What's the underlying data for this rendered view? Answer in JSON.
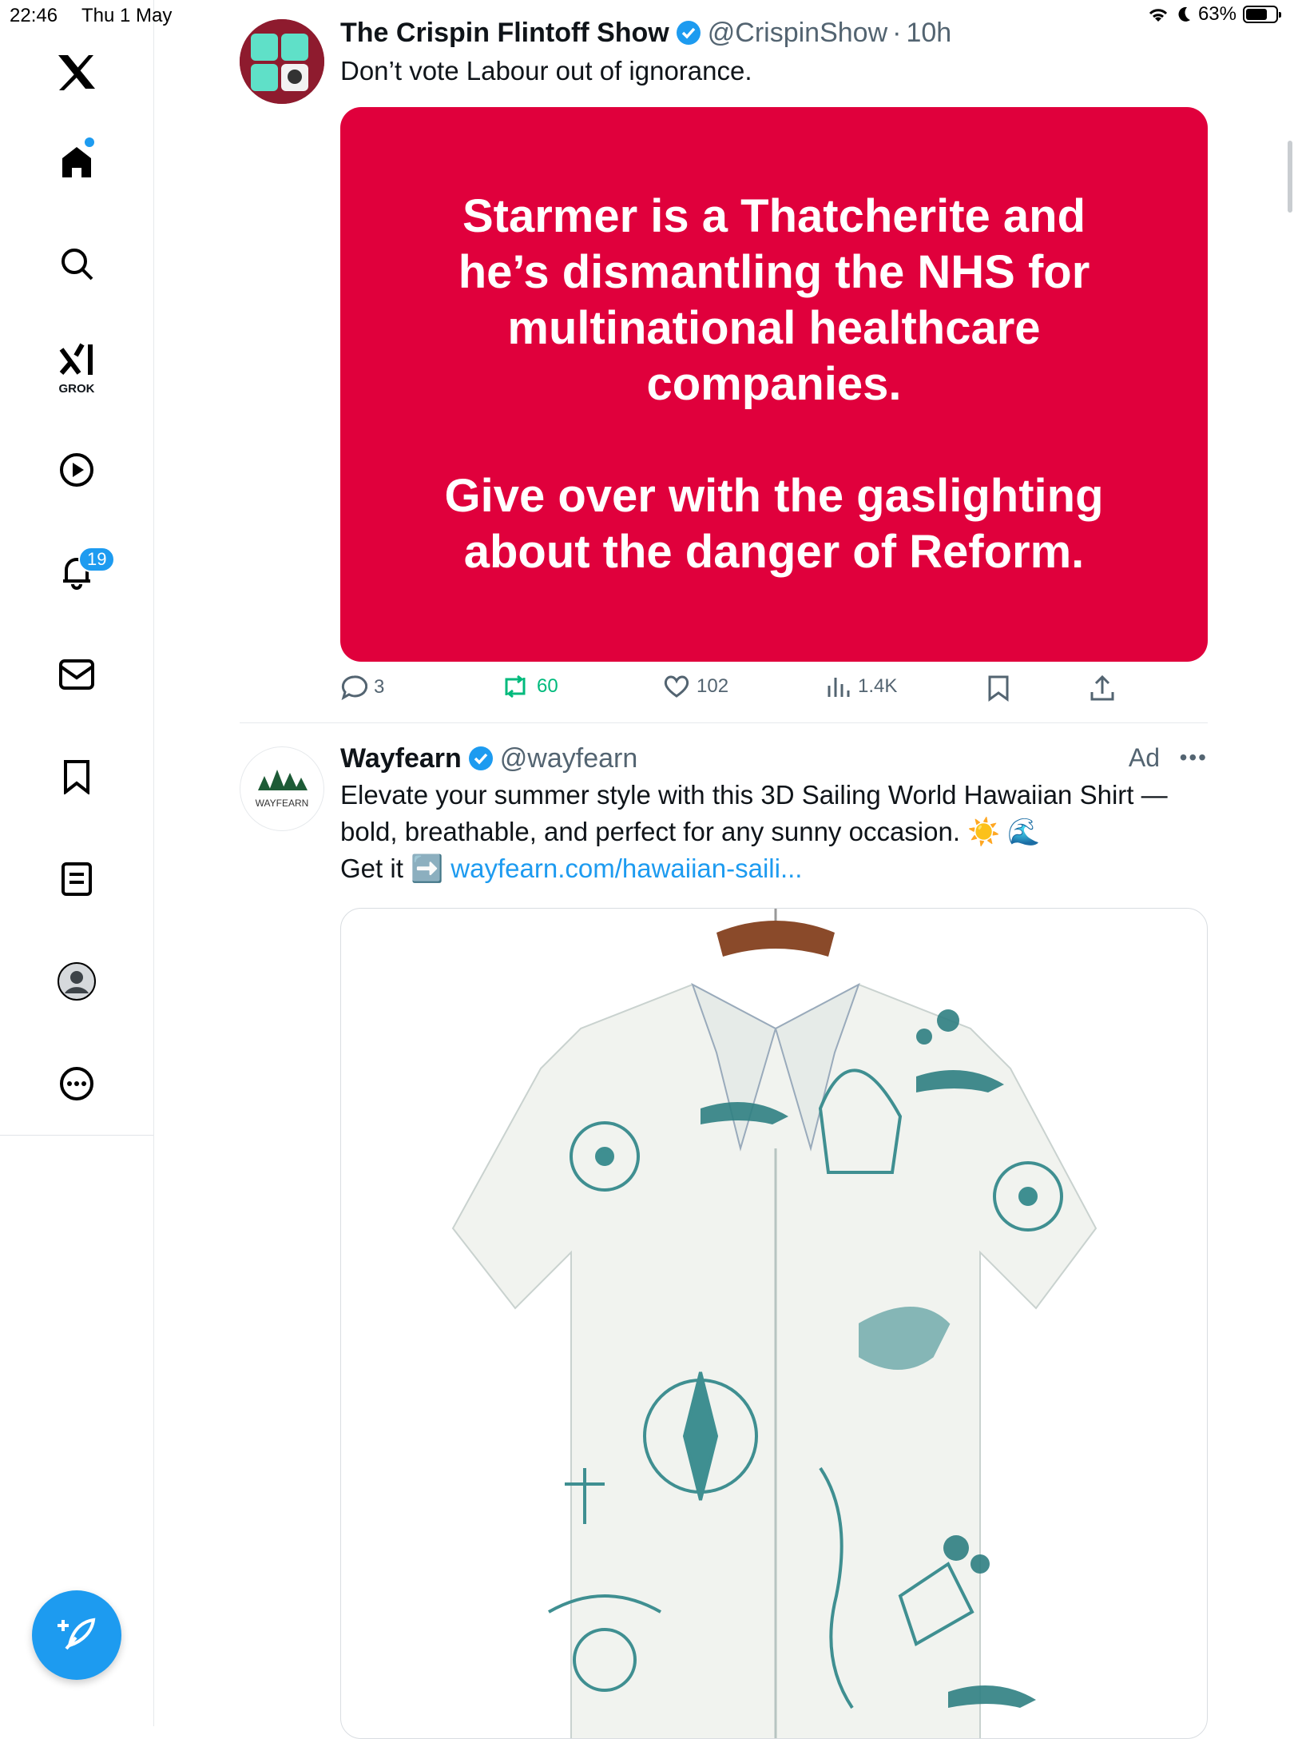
{
  "status_bar": {
    "time": "22:46",
    "date": "Thu 1 May",
    "battery": "63%"
  },
  "sidebar": {
    "grok_label": "GROK",
    "notifications_count": "19",
    "icons": [
      "x-logo-icon",
      "home-icon",
      "search-icon",
      "grok-icon",
      "video-icon",
      "bell-icon",
      "mail-icon",
      "bookmark-icon",
      "lists-icon",
      "profile-icon",
      "more-icon",
      "compose-icon"
    ]
  },
  "colors": {
    "accent": "#1d9bf0",
    "card_red": "#e0003c",
    "muted": "#536471"
  },
  "feed": {
    "post1": {
      "name": "The Crispin Flintoff Show",
      "handle": "@CrispinShow",
      "separator": "·",
      "time": "10h",
      "text": "Don’t vote Labour out of ignorance.",
      "card_lines_1": [
        "Starmer is a Thatcherite and",
        "he’s dismantling the NHS for",
        "multinational healthcare",
        "companies."
      ],
      "card_lines_2": [
        "Give over with the gaslighting",
        "about the danger of Reform."
      ],
      "replies": "3",
      "reposts": "60",
      "likes": "102",
      "views": "1.4K"
    },
    "post2": {
      "name": "Wayfearn",
      "handle": "@wayfearn",
      "ad_label": "Ad",
      "text_line1": "Elevate your summer style with this 3D Sailing World Hawaiian Shirt —",
      "text_line2": "bold, breathable, and perfect for any sunny occasion. ☀️ 🌊",
      "text_line3_prefix": "Get it ➡️ ",
      "link": "wayfearn.com/hawaiian-saili...",
      "avatar_text": "WAYFEARN"
    }
  }
}
